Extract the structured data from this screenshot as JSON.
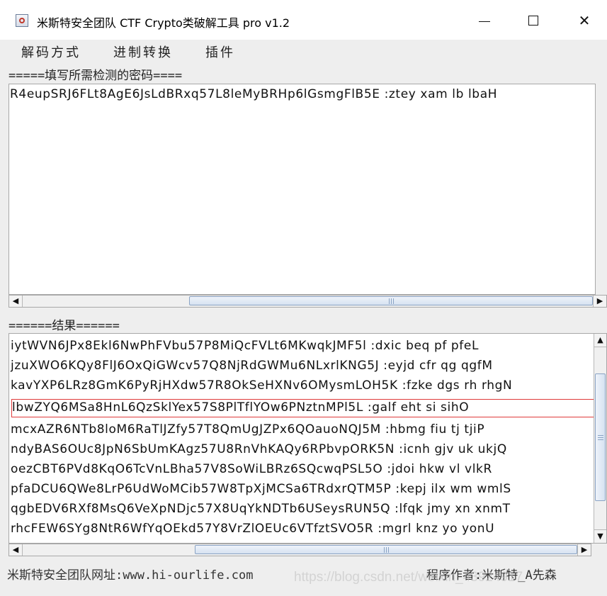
{
  "window": {
    "title": "米斯特安全团队 CTF Crypto类破解工具 pro v1.2",
    "minimize_label": "—",
    "maximize_label": "☐",
    "close_label": "✕"
  },
  "menu": {
    "items": [
      {
        "label": "解码方式"
      },
      {
        "label": "进制转换"
      },
      {
        "label": "插件"
      }
    ]
  },
  "input_section": {
    "label": "=====填写所需检测的密码====",
    "value": "R4eupSRJ6FLt8AgE6JsLdBRxq57L8leMyBRHp6lGsmgFlB5E :ztey xam lb lbaH"
  },
  "result_section": {
    "label": "======结果======",
    "rows": [
      {
        "text": "iytWVN6JPx8Ekl6NwPhFVbu57P8MiQcFVLt6MKwqkJMF5l :dxic beq pf pfeL"
      },
      {
        "text": "jzuXWO6KQy8FlJ6OxQiGWcv57Q8NjRdGWMu6NLxrlKNG5J :eyjd cfr qg qgfM"
      },
      {
        "text": "kavYXP6LRz8GmK6PyRjHXdw57R8OkSeHXNv6OMysmLOH5K :fzke dgs rh rhgN"
      },
      {
        "text": "lbwZYQ6MSa8HnL6QzSklYex57S8PlTflYOw6PNztnMPl5L :galf eht si sihO",
        "highlighted": true
      },
      {
        "text": "mcxAZR6NTb8loM6RaTlJZfy57T8QmUgJZPx6QOauoNQJ5M :hbmg fiu tj tjiP"
      },
      {
        "text": "ndyBAS6OUc8JpN6SbUmKAgz57U8RnVhKAQy6RPbvpORK5N :icnh gjv uk ukjQ"
      },
      {
        "text": "oezCBT6PVd8KqO6TcVnLBha57V8SoWiLBRz6SQcwqPSL5O :jdoi hkw vl vlkR"
      },
      {
        "text": "pfaDCU6QWe8LrP6UdWoMCib57W8TpXjMCSa6TRdxrQTM5P :kepj ilx wm wmlS"
      },
      {
        "text": "qgbEDV6RXf8MsQ6VeXpNDjc57X8UqYkNDTb6USeysRUN5Q :lfqk jmy xn xnmT"
      },
      {
        "text": "rhcFEW6SYg8NtR6WfYqOEkd57Y8VrZlOEUc6VTfztSVO5R :mgrl knz yo yonU"
      }
    ]
  },
  "status": {
    "left": "米斯特安全团队网址:www.hi-ourlife.com",
    "right": "程序作者:米斯特_A先森"
  },
  "watermark": "https://blog.csdn.net/weixin_43924917",
  "colors": {
    "highlight_border": "#e03a3a",
    "scroll_thumb": "#d6e2f1"
  }
}
